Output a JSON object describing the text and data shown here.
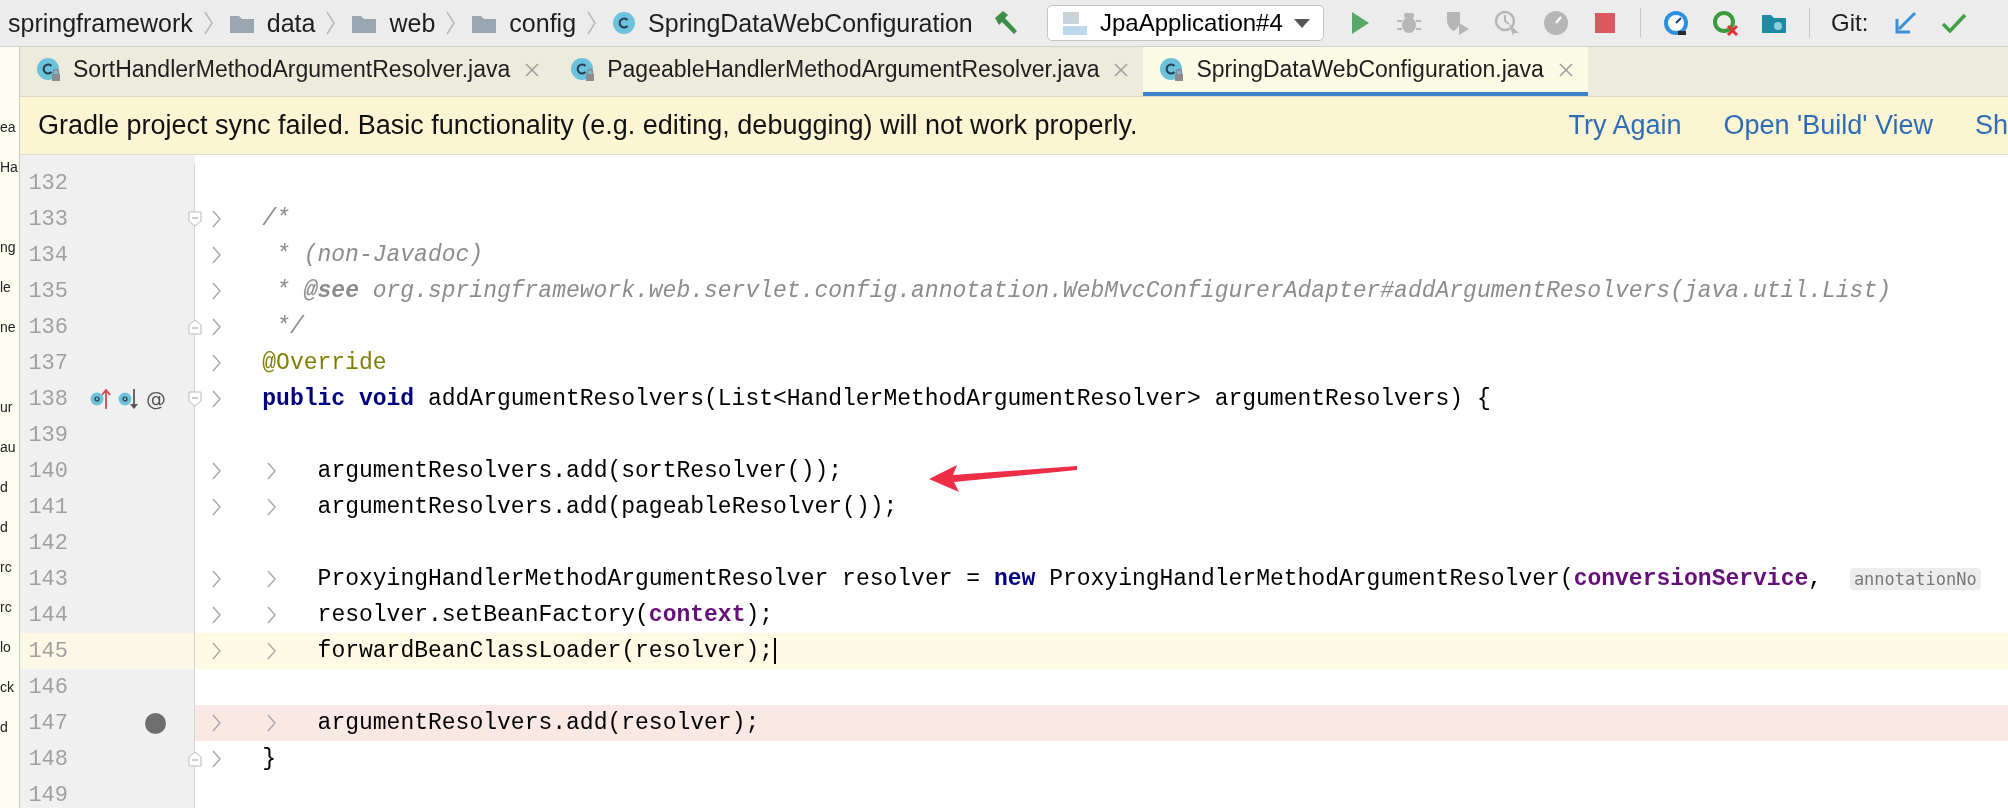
{
  "breadcrumb": [
    {
      "kind": "text",
      "text": "springframework"
    },
    {
      "kind": "folder",
      "text": "data"
    },
    {
      "kind": "folder",
      "text": "web"
    },
    {
      "kind": "folder",
      "text": "config"
    },
    {
      "kind": "class",
      "text": "SpringDataWebConfiguration"
    }
  ],
  "toolbar": {
    "items": [
      {
        "kind": "build",
        "disabled": false
      },
      {
        "kind": "run_config",
        "text": "JpaApplication#4"
      },
      {
        "kind": "run",
        "disabled": false
      },
      {
        "kind": "debug",
        "disabled": true
      },
      {
        "kind": "coverage",
        "disabled": true
      },
      {
        "kind": "profile",
        "disabled": true
      },
      {
        "kind": "gauge",
        "disabled": true
      },
      {
        "kind": "stop",
        "disabled": false
      },
      {
        "kind": "separator"
      },
      {
        "kind": "monitor",
        "disabled": false
      },
      {
        "kind": "nosync",
        "disabled": false
      },
      {
        "kind": "folder",
        "disabled": false
      },
      {
        "kind": "separator"
      },
      {
        "kind": "label",
        "text": "Git:"
      },
      {
        "kind": "update",
        "disabled": false
      },
      {
        "kind": "commit",
        "disabled": false
      }
    ]
  },
  "project_panel": {
    "fragments": [
      "ea",
      "Ha",
      "ng",
      "le",
      "ne",
      "ur",
      "au",
      "d",
      "d",
      "rc",
      "rc",
      "lo",
      "ck",
      "d"
    ]
  },
  "tabs": [
    {
      "label": "SortHandlerMethodArgumentResolver.java",
      "selected": false
    },
    {
      "label": "PageableHandlerMethodArgumentResolver.java",
      "selected": false
    },
    {
      "label": "SpringDataWebConfiguration.java",
      "selected": true
    }
  ],
  "banner": {
    "message": "Gradle project sync failed. Basic functionality (e.g. editing, debugging) will not work properly.",
    "links": [
      "Try Again",
      "Open 'Build' View",
      "Sh"
    ]
  },
  "editor": {
    "lines": [
      {
        "number": "132"
      },
      {
        "number": "133",
        "fold_start": true,
        "tokens": [
          {
            "kind": "comment",
            "text": "/*"
          }
        ]
      },
      {
        "number": "134",
        "tokens": [
          {
            "kind": "comment",
            "text": " * (non-Javadoc)"
          }
        ]
      },
      {
        "number": "135",
        "tokens": [
          {
            "kind": "comment",
            "text": " * "
          },
          {
            "kind": "doc_tag",
            "text": "@see"
          },
          {
            "kind": "comment",
            "text": " org.springframework.web.servlet.config.annotation.WebMvcConfigurerAdapter#addArgumentResolvers(java.util.List)"
          }
        ]
      },
      {
        "number": "136",
        "fold_end": true,
        "tokens": [
          {
            "kind": "comment",
            "text": " */"
          }
        ]
      },
      {
        "number": "137",
        "tokens": [
          {
            "kind": "annotation",
            "text": "@Override"
          }
        ]
      },
      {
        "number": "138",
        "fold_start": true,
        "gutter_marks": [
          {
            "kind": "overriding"
          },
          {
            "kind": "implemented"
          },
          {
            "kind": "text",
            "text": "@"
          }
        ],
        "tokens": [
          {
            "kind": "keyword",
            "text": "public void"
          },
          {
            "kind": "plain",
            "text": " addArgumentResolvers(List<HandlerMethodArgumentResolver> argumentResolvers) {"
          }
        ],
        "children": [
          {
            "number": "139"
          },
          {
            "number": "140",
            "tokens": [
              {
                "kind": "plain",
                "text": "argumentResolvers.add(sortResolver());"
              }
            ]
          },
          {
            "number": "141",
            "tokens": [
              {
                "kind": "plain",
                "text": "argumentResolvers.add(pageableResolver());"
              }
            ]
          },
          {
            "number": "142"
          },
          {
            "number": "143",
            "tokens": [
              {
                "kind": "plain",
                "text": "ProxyingHandlerMethodArgumentResolver resolver = "
              },
              {
                "kind": "keyword",
                "text": "new"
              },
              {
                "kind": "plain",
                "text": " ProxyingHandlerMethodArgumentResolver("
              },
              {
                "kind": "field",
                "text": "conversionService"
              },
              {
                "kind": "plain",
                "text": ", "
              }
            ],
            "hint": "annotationNo"
          },
          {
            "number": "144",
            "tokens": [
              {
                "kind": "plain",
                "text": "resolver.setBeanFactory("
              },
              {
                "kind": "field",
                "text": "context"
              },
              {
                "kind": "plain",
                "text": ");"
              }
            ]
          },
          {
            "number": "145",
            "current_line": true,
            "caret": true,
            "tokens": [
              {
                "kind": "plain",
                "text": "forwardBeanClassLoader(resolver);"
              }
            ]
          },
          {
            "number": "146"
          },
          {
            "number": "147",
            "breakpoint": true,
            "tokens": [
              {
                "kind": "plain",
                "text": "argumentResolvers.add(resolver);"
              }
            ]
          }
        ]
      },
      {
        "number": "148",
        "fold_end": true,
        "tokens": [
          {
            "kind": "plain",
            "text": "}"
          }
        ]
      },
      {
        "number": "149"
      }
    ]
  },
  "annotation": {
    "kind": "arrow"
  }
}
